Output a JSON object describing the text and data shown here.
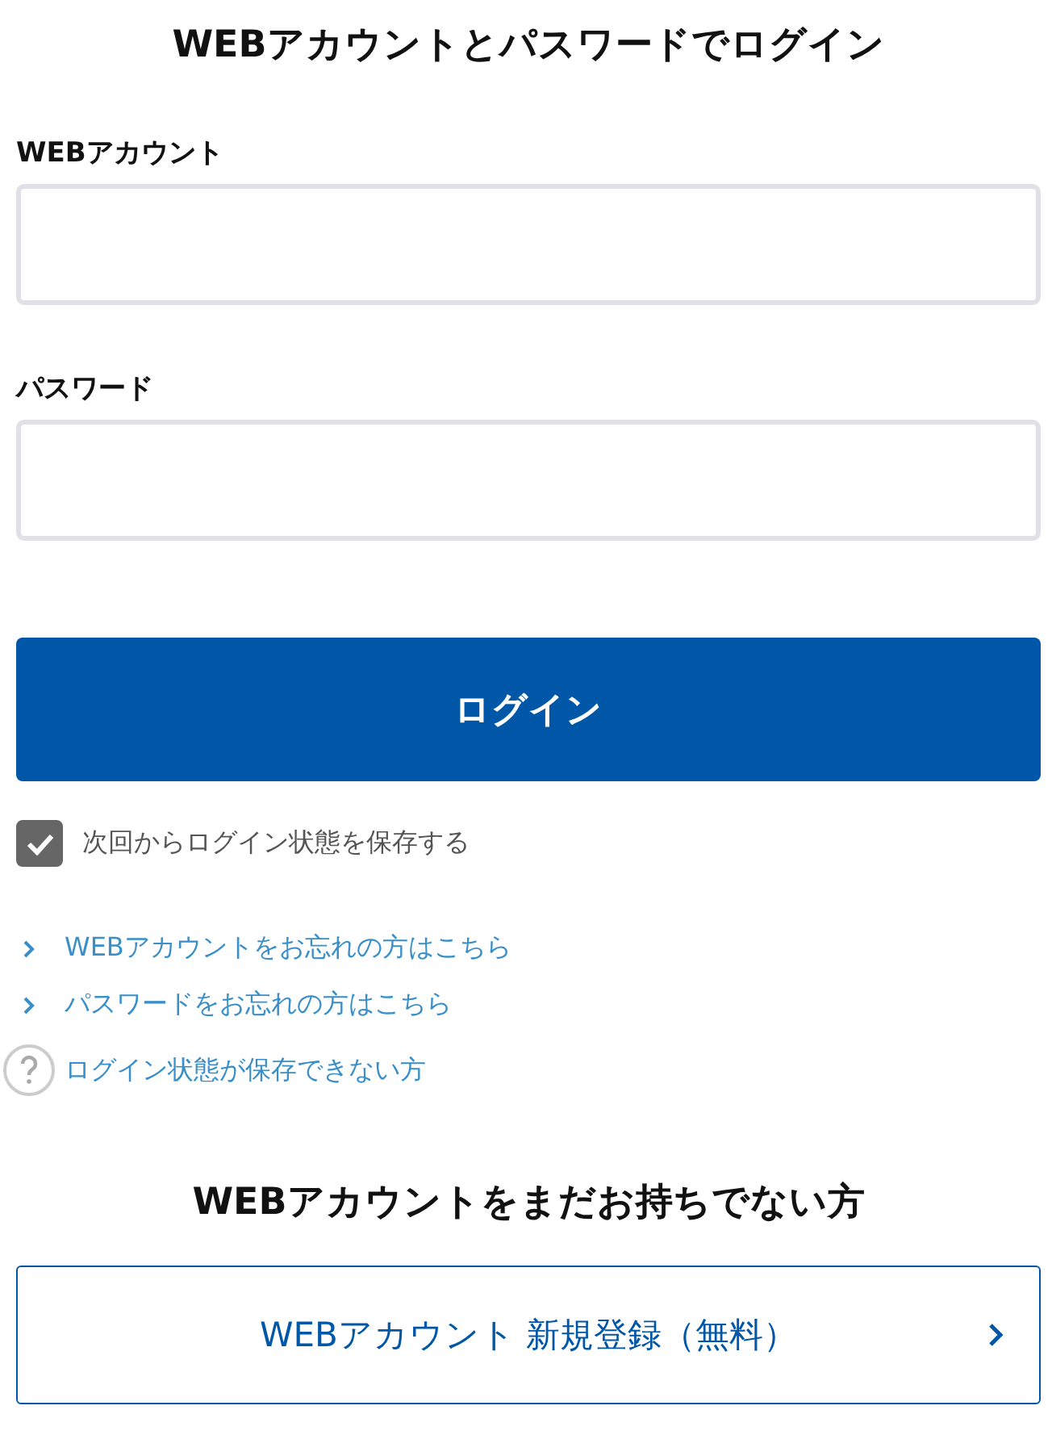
{
  "title": "WEBアカウントとパスワードでログイン",
  "fields": [
    {
      "label": "WEBアカウント"
    },
    {
      "label": "パスワード"
    }
  ],
  "login_button": "ログイン",
  "remember": {
    "label": "次回からログイン状態を保存する",
    "checked": true
  },
  "links": [
    {
      "kind": "chevron",
      "text": "WEBアカウントをお忘れの方はこちら"
    },
    {
      "kind": "chevron",
      "text": "パスワードをお忘れの方はこちら"
    },
    {
      "kind": "help",
      "text": "ログイン状態が保存できない方"
    }
  ],
  "register": {
    "heading": "WEBアカウントをまだお持ちでない方",
    "button": "WEBアカウント 新規登録（無料）"
  }
}
